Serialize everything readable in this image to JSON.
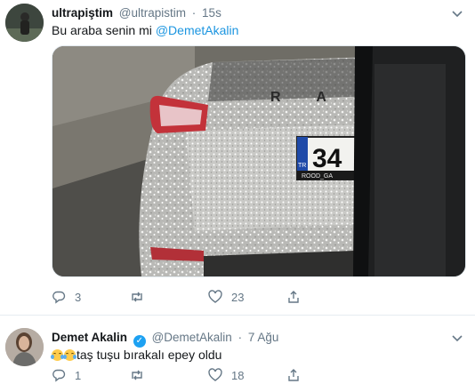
{
  "tweets": [
    {
      "display_name": "ultrapiştim",
      "handle": "@ultrapistim",
      "separator": "·",
      "time": "15s",
      "text": "Bu araba senin mi",
      "mention": "@DemetAkalin",
      "media": {
        "plate_number": "34",
        "plate_country": "TR",
        "badge_letters": "R  A",
        "dealer_strip": "ROOD_GA"
      },
      "actions": {
        "reply_count": "3",
        "retweet_count": "",
        "like_count": "23"
      }
    },
    {
      "display_name": "Demet Akalin",
      "handle": "@DemetAkalin",
      "separator": "·",
      "time": "7 Ağu",
      "text": "taş tuşu bırakalı epey oldu",
      "actions": {
        "reply_count": "1",
        "retweet_count": "",
        "like_count": "18"
      }
    }
  ],
  "icons": {
    "reply": "reply-icon",
    "retweet": "retweet-icon",
    "like": "heart-icon",
    "share": "share-icon",
    "more": "chevron-down-icon",
    "verified": "verified-badge-icon"
  },
  "colors": {
    "link": "#1b95e0",
    "muted": "#657786",
    "verified": "#1da1f2"
  }
}
